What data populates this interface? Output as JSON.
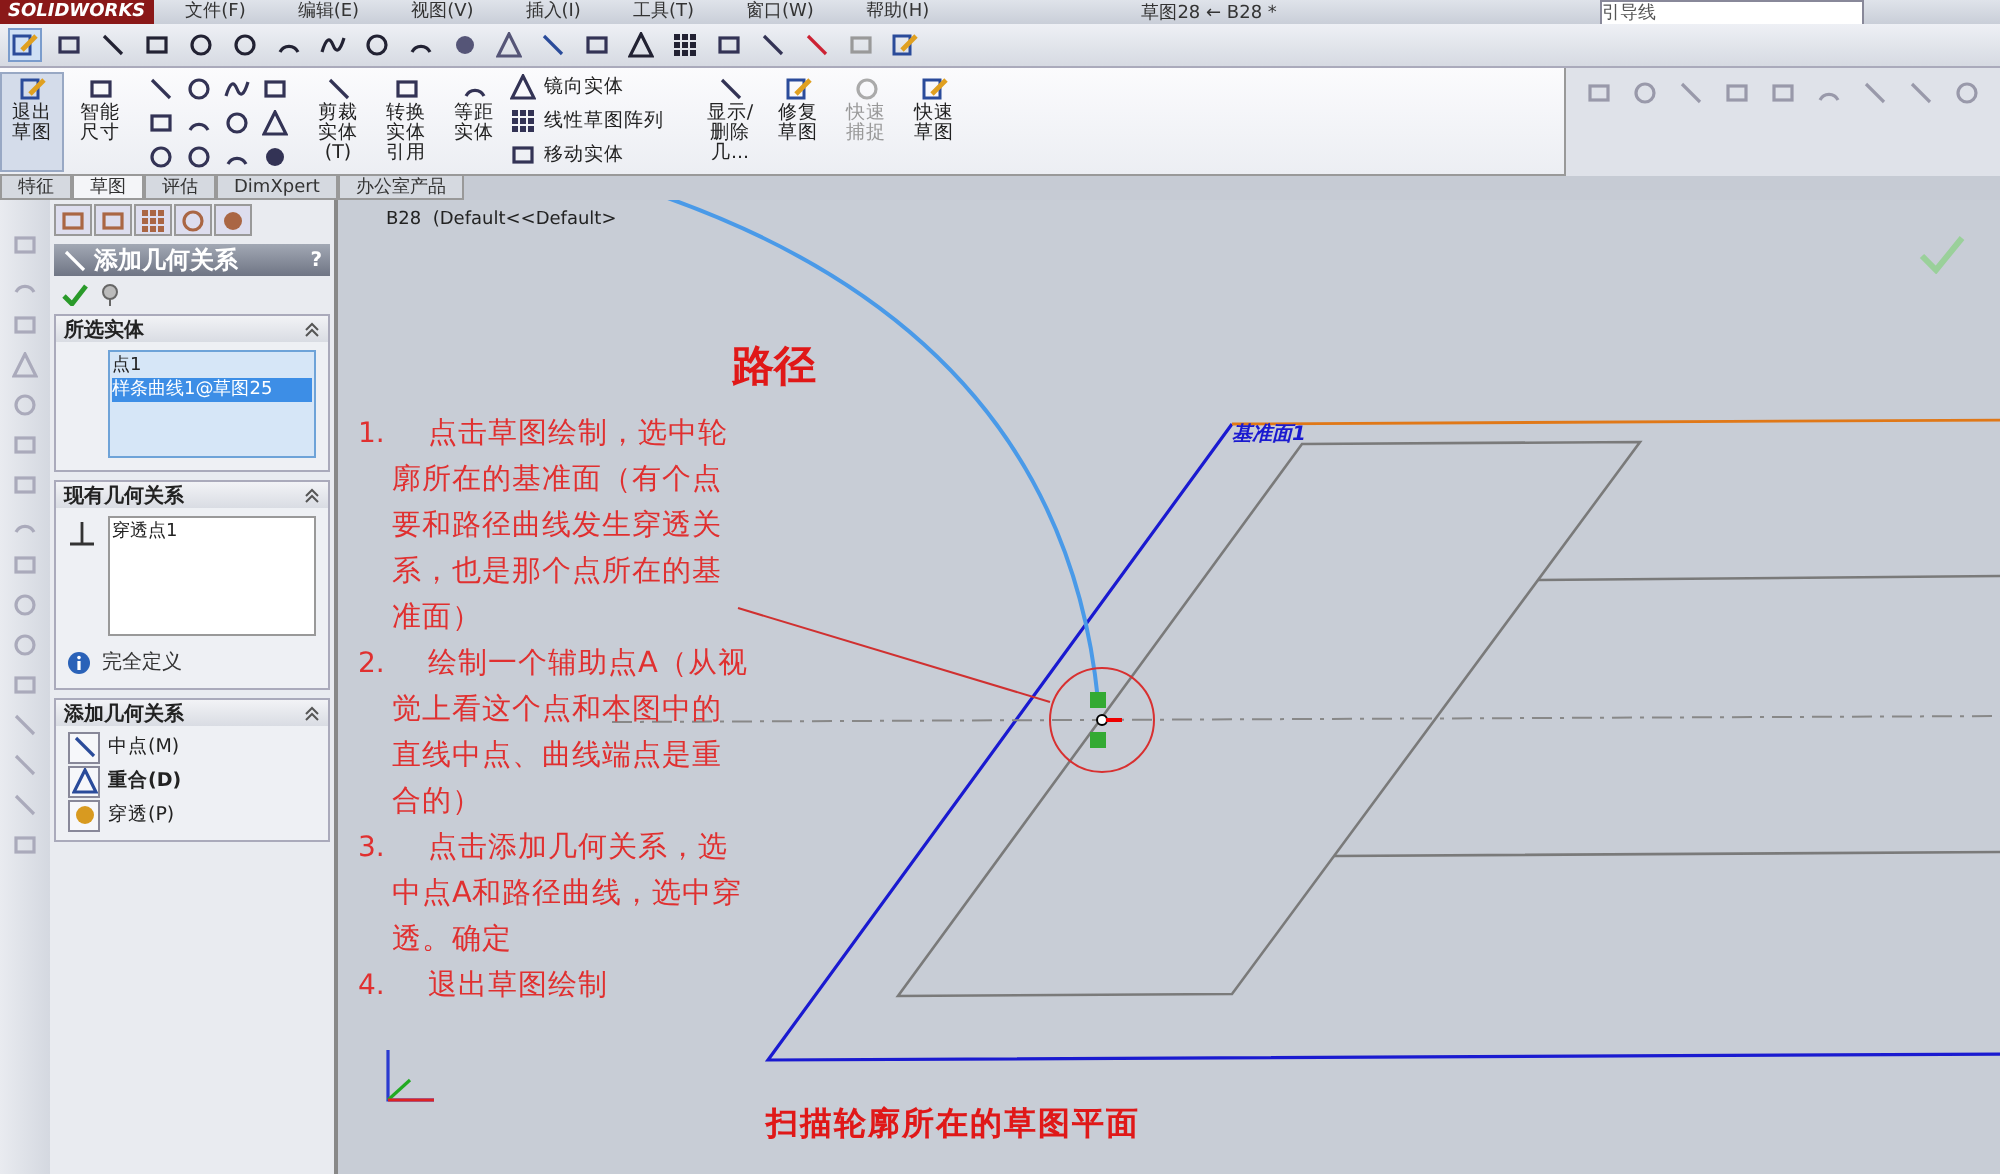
{
  "menu_bar": {
    "logo": "SOLIDWORKS",
    "menus": [
      "文件(F)",
      "编辑(E)",
      "视图(V)",
      "插入(I)",
      "工具(T)",
      "窗口(W)",
      "帮助(H)"
    ],
    "document_title": "草图28 ← B28 *",
    "search": {
      "value": "引导线"
    }
  },
  "ribbon": {
    "large_buttons": [
      {
        "label": "退出草图",
        "selected": true,
        "disabled": false
      },
      {
        "label": "智能尺寸",
        "selected": false,
        "disabled": false
      }
    ],
    "tool_buttons": [
      {
        "label": "剪裁实体(T)",
        "disabled": false
      },
      {
        "label": "转换实体引用",
        "disabled": false
      },
      {
        "label": "等距实体",
        "disabled": false
      }
    ],
    "list_buttons": [
      "镜向实体",
      "线性草图阵列",
      "移动实体"
    ],
    "end_buttons": [
      {
        "label": "显示/删除几...",
        "disabled": false
      },
      {
        "label": "修复草图",
        "disabled": false
      },
      {
        "label": "快速捕捉",
        "disabled": true
      },
      {
        "label": "快速草图",
        "disabled": false
      }
    ]
  },
  "ribbon_tabs": [
    {
      "label": "特征",
      "selected": false
    },
    {
      "label": "草图",
      "selected": true
    },
    {
      "label": "评估",
      "selected": false
    },
    {
      "label": "DimXpert",
      "selected": false
    },
    {
      "label": "办公室产品",
      "selected": false
    }
  ],
  "property_manager": {
    "title": "添加几何关系",
    "help": "?",
    "selected_entities": {
      "title": "所选实体",
      "items": [
        {
          "label": "点1",
          "selected": false
        },
        {
          "label": "样条曲线1@草图25",
          "selected": true
        }
      ]
    },
    "existing_relations": {
      "title": "现有几何关系",
      "items": [
        "穿透点1"
      ],
      "status": "完全定义"
    },
    "add_relations": {
      "title": "添加几何关系",
      "items": [
        {
          "label": "中点(M)",
          "bold": false
        },
        {
          "label": "重合(D)",
          "bold": true
        },
        {
          "label": "穿透(P)",
          "bold": false
        }
      ]
    }
  },
  "graphics": {
    "tree_label": "B28  (Default<<Default>",
    "plane_label": "基准面1",
    "path_label": "路径",
    "steps": [
      {
        "number": "1.",
        "text": "点击草图绘制，选中轮廓所在的基准面（有个点要和路径曲线发生穿透关系，也是那个点所在的基准面）"
      },
      {
        "number": "2.",
        "text": "绘制一个辅助点A（从视觉上看这个点和本图中的直线中点、曲线端点是重合的）"
      },
      {
        "number": "3.",
        "text": "点击添加几何关系，选中点A和路径曲线，选中穿透。确定"
      },
      {
        "number": "4.",
        "text": "退出草图绘制"
      }
    ],
    "caption": "扫描轮廓所在的草图平面"
  }
}
